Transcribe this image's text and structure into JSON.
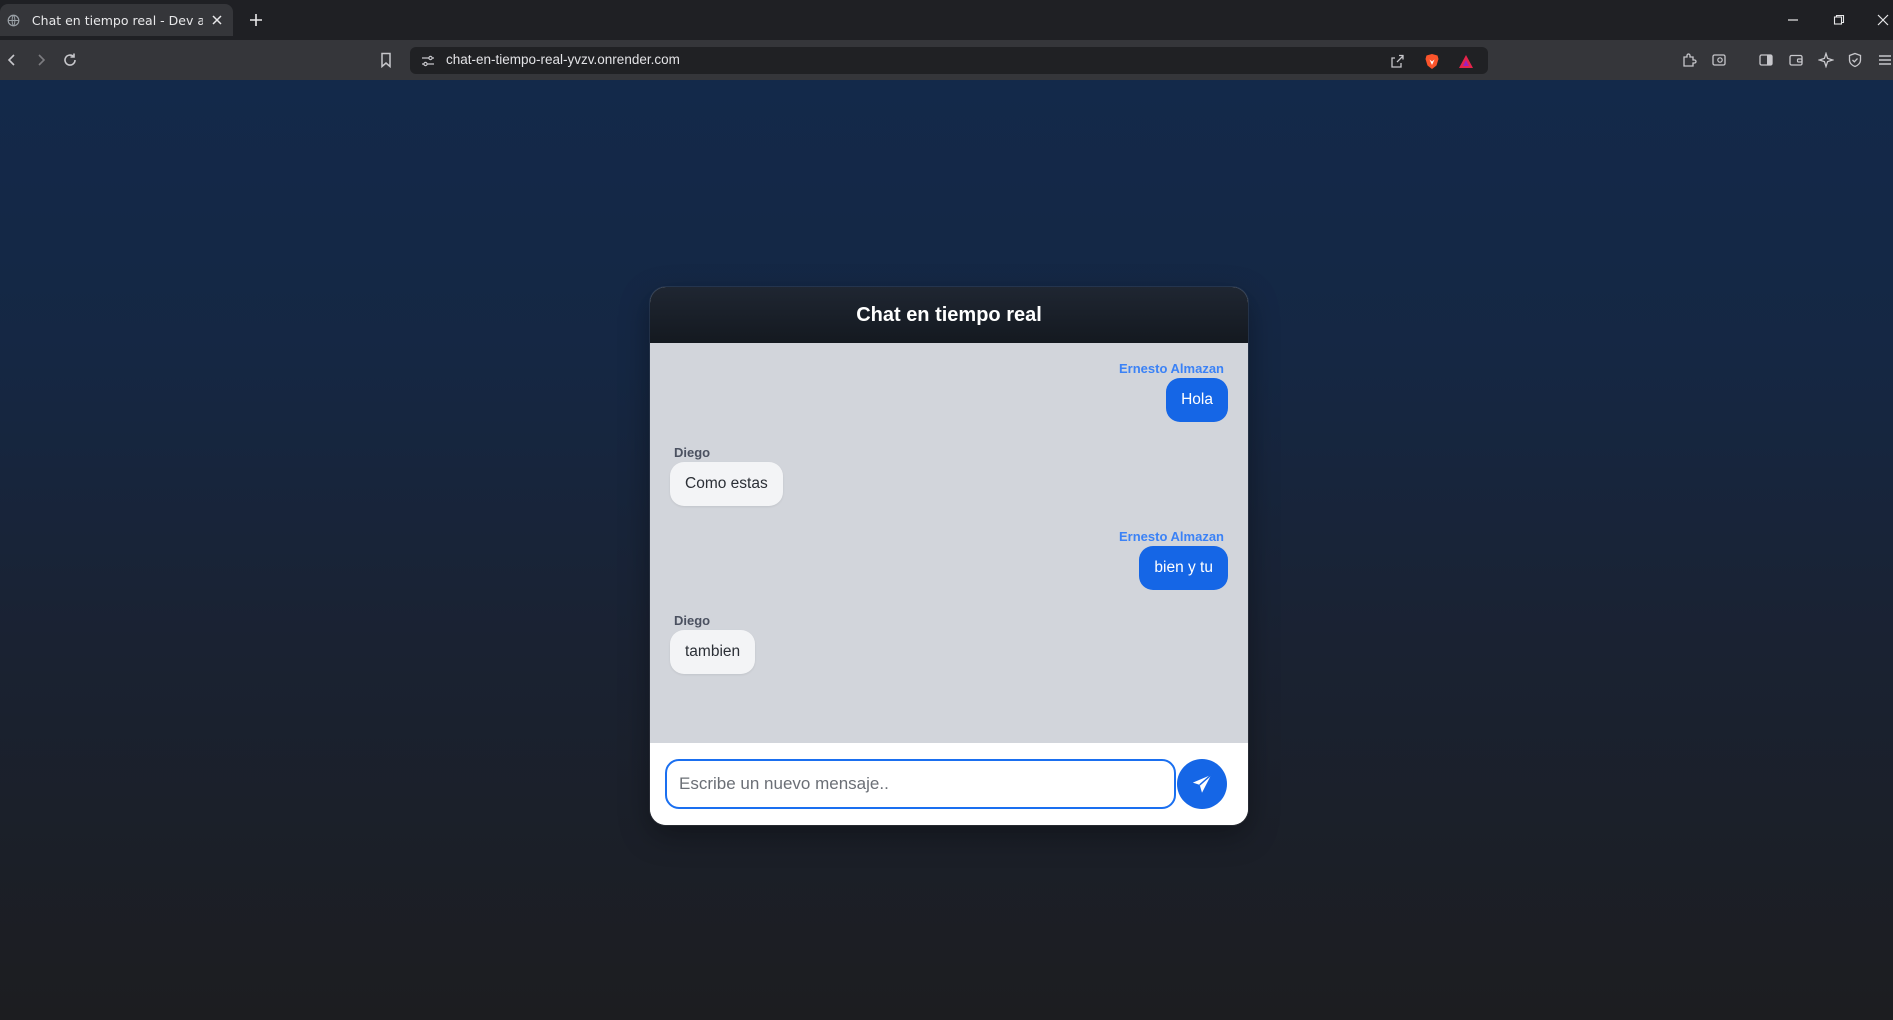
{
  "browser": {
    "tab_title": "Chat en tiempo real - Dev almazan",
    "url": "chat-en-tiempo-real-yvzv.onrender.com"
  },
  "chat": {
    "title": "Chat en tiempo real",
    "messages": [
      {
        "author": "Ernesto Almazan",
        "text": "Hola",
        "direction": "sent"
      },
      {
        "author": "Diego",
        "text": "Como estas",
        "direction": "received"
      },
      {
        "author": "Ernesto Almazan",
        "text": "bien y tu",
        "direction": "sent"
      },
      {
        "author": "Diego",
        "text": "tambien",
        "direction": "received"
      }
    ],
    "input": {
      "placeholder": "Escribe un nuevo mensaje..",
      "value": ""
    },
    "send_icon": "paper-plane-icon"
  },
  "colors": {
    "accent": "#1566e6",
    "sent_author": "#3b82f6",
    "messages_bg": "#d2d5db",
    "header_bg": "#141920",
    "page_bg_top": "#13294a",
    "page_bg_bottom": "#1c1d20"
  }
}
